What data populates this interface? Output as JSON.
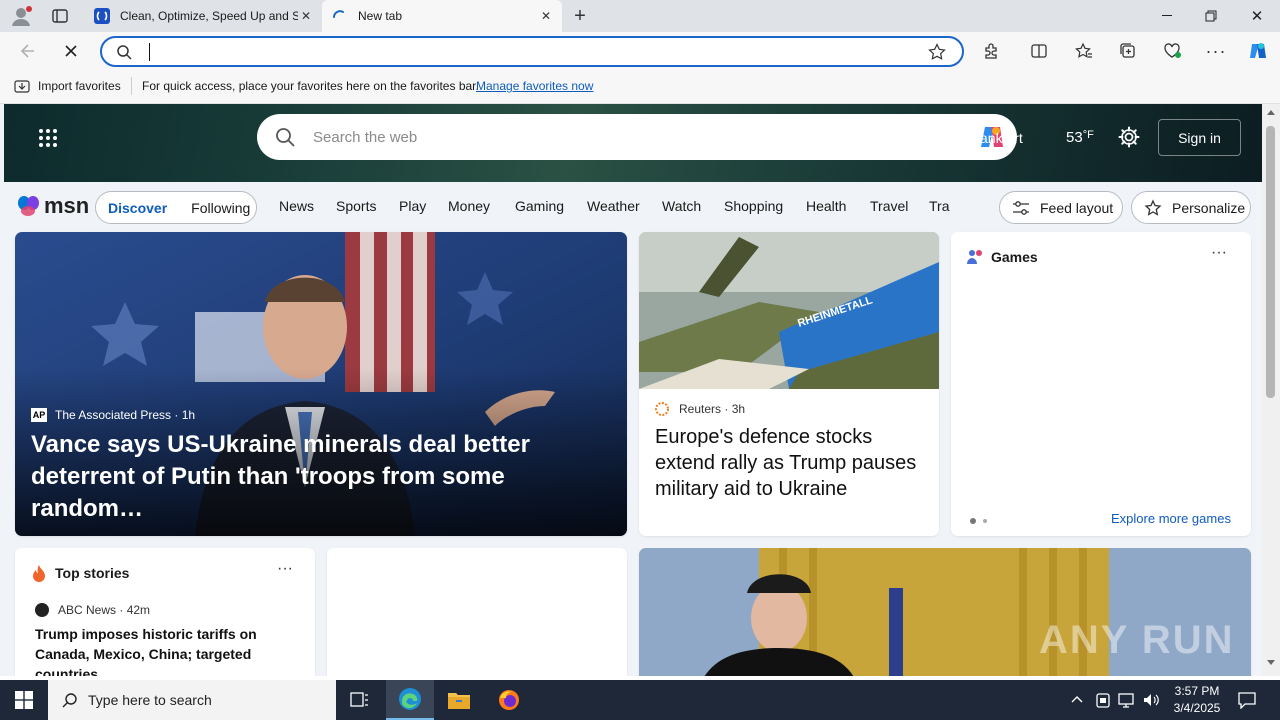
{
  "browser": {
    "tabs": [
      {
        "title": "Clean, Optimize, Speed Up and Se"
      },
      {
        "title": "New tab"
      }
    ],
    "address_value": "",
    "favorites_bar": {
      "import_label": "Import favorites",
      "message": "For quick access, place your favorites here on the favorites bar.",
      "manage_link": "Manage favorites now"
    }
  },
  "msn": {
    "search_placeholder": "Search the web",
    "location": "ankfurt",
    "temperature": "53",
    "temp_unit": "°F",
    "sign_in": "Sign in",
    "logo_text": "msn",
    "feed_tabs": [
      "Discover",
      "Following"
    ],
    "nav_links": [
      "News",
      "Sports",
      "Play",
      "Money",
      "Gaming",
      "Weather",
      "Watch",
      "Shopping",
      "Health",
      "Travel",
      "Tra"
    ],
    "feed_layout": "Feed layout",
    "personalize": "Personalize",
    "hero_story": {
      "source": "The Associated Press",
      "age": "1h",
      "headline": "Vance says US-Ukraine minerals deal better deterrent of Putin than 'troops from some random…"
    },
    "story2": {
      "source": "Reuters",
      "age": "3h",
      "headline": "Europe's defence stocks extend rally as Trump pauses military aid to Ukraine",
      "image_text": "RHEINMETALL"
    },
    "games": {
      "title": "Games",
      "more": "Explore more games"
    },
    "top_stories": {
      "title": "Top stories",
      "source": "ABC News",
      "age": "42m",
      "headline": "Trump imposes historic tariffs on Canada, Mexico, China; targeted countries..."
    },
    "watermark": "ANY RUN"
  },
  "taskbar": {
    "search_placeholder": "Type here to search",
    "time": "3:57 PM",
    "date": "3/4/2025"
  },
  "colors": {
    "accent": "#1b66c9",
    "taskbar": "#1e2838",
    "link": "#0f5cbf"
  }
}
